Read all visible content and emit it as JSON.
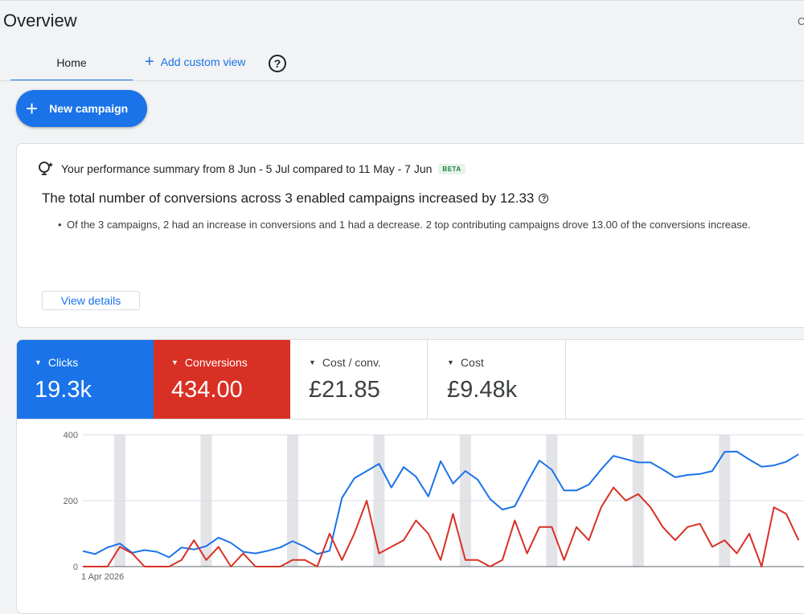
{
  "header": {
    "title": "Overview",
    "right_clipped_text": "C",
    "tabs": [
      {
        "label": "Home"
      }
    ],
    "add_view_label": "Add custom view"
  },
  "actions": {
    "new_campaign_label": "New campaign"
  },
  "summary": {
    "heading": "Your performance summary from 8 Jun - 5 Jul compared to 11 May - 7 Jun",
    "badge": "BETA",
    "headline": "The total number of conversions across 3 enabled campaigns increased by 12.33",
    "bullet": "Of the 3 campaigns, 2 had an increase in conversions and 1 had a decrease. 2 top contributing campaigns drove 13.00 of the conversions increase.",
    "view_details_label": "View details"
  },
  "metrics": [
    {
      "label": "Clicks",
      "value": "19.3k",
      "color": "#1a73e8",
      "selected": true
    },
    {
      "label": "Conversions",
      "value": "434.00",
      "color": "#d93025",
      "selected": true
    },
    {
      "label": "Cost / conv.",
      "value": "£21.85",
      "selected": false
    },
    {
      "label": "Cost",
      "value": "£9.48k",
      "selected": false
    }
  ],
  "chart_data": {
    "type": "line",
    "x_start_label": "1 Apr 2026",
    "yticks": [
      "400",
      "200",
      "0"
    ],
    "ylim": [
      0,
      400
    ],
    "weekend_bands": true,
    "series": [
      {
        "name": "Clicks",
        "color": "#1a73e8",
        "values": [
          47,
          38,
          58,
          70,
          42,
          50,
          45,
          28,
          58,
          52,
          62,
          88,
          72,
          45,
          40,
          48,
          58,
          77,
          60,
          38,
          48,
          208,
          268,
          290,
          312,
          240,
          302,
          273,
          213,
          320,
          252,
          290,
          264,
          205,
          173,
          183,
          255,
          322,
          294,
          231,
          231,
          249,
          295,
          336,
          326,
          316,
          316,
          295,
          271,
          278,
          281,
          290,
          348,
          349,
          325,
          303,
          307,
          318,
          341
        ]
      },
      {
        "name": "Conversions",
        "color": "#d93025",
        "values": [
          0,
          0,
          0,
          60,
          40,
          0,
          0,
          0,
          20,
          80,
          20,
          60,
          0,
          40,
          0,
          0,
          0,
          20,
          20,
          0,
          100,
          20,
          100,
          200,
          40,
          60,
          80,
          140,
          100,
          20,
          160,
          20,
          20,
          0,
          20,
          140,
          40,
          120,
          120,
          20,
          120,
          80,
          180,
          240,
          200,
          220,
          180,
          120,
          80,
          120,
          130,
          60,
          80,
          40,
          100,
          0,
          180,
          160,
          80
        ]
      }
    ]
  }
}
